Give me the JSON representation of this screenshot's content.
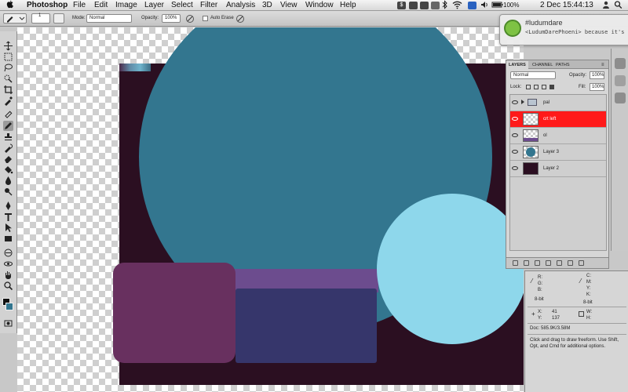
{
  "menubar": {
    "apple": "",
    "app": "Photoshop",
    "items": [
      "File",
      "Edit",
      "Image",
      "Layer",
      "Select",
      "Filter",
      "Analysis",
      "3D",
      "View",
      "Window",
      "Help"
    ],
    "clock": "2 Dec  15:44:13",
    "battery_pct": "100%"
  },
  "options_bar": {
    "mode_label": "Mode:",
    "mode_value": "Normal",
    "opacity_label": "Opacity:",
    "opacity_value": "100%",
    "auto_erase_label": "Auto Erase",
    "brush_size": "1"
  },
  "notification": {
    "title": "#ludumdare",
    "message": "<LudumDarePhoeni> because it's the"
  },
  "layers_panel": {
    "tabs": [
      "LAYERS",
      "CHANNEL",
      "PATHS"
    ],
    "blend_mode": "Normal",
    "opacity_label": "Opacity:",
    "opacity_value": "100%",
    "lock_label": "Lock:",
    "fill_label": "Fill:",
    "fill_value": "100%",
    "layers": [
      {
        "name": "pal",
        "type": "group"
      },
      {
        "name": "crt left",
        "selected": true
      },
      {
        "name": "ol"
      },
      {
        "name": "Layer 3"
      },
      {
        "name": "Layer 2"
      }
    ]
  },
  "info_panel": {
    "r": "R:",
    "g": "G:",
    "b": "B:",
    "c": "C:",
    "m": "M:",
    "y": "Y:",
    "k": "K:",
    "bit_left": "8-bit",
    "bit_right": "8-bit",
    "x_label": "X:",
    "x_value": "41",
    "y_label": "Y:",
    "y_value": "137",
    "w_label": "W:",
    "h_label": "H:",
    "doc": "Doc: 585.9K/3.58M",
    "hint": "Click and drag to draw freeform.  Use Shift, Opt, and Cmd for additional options."
  },
  "colors": {
    "big_circle": "#33768f",
    "light_circle": "#8ed7eb",
    "artboard": "#2b0f21",
    "plum_rect": "#68305f",
    "navy_rect": "#36366b",
    "purple_bar": "#6c4c8e",
    "selected_layer": "#ff1a1a"
  }
}
